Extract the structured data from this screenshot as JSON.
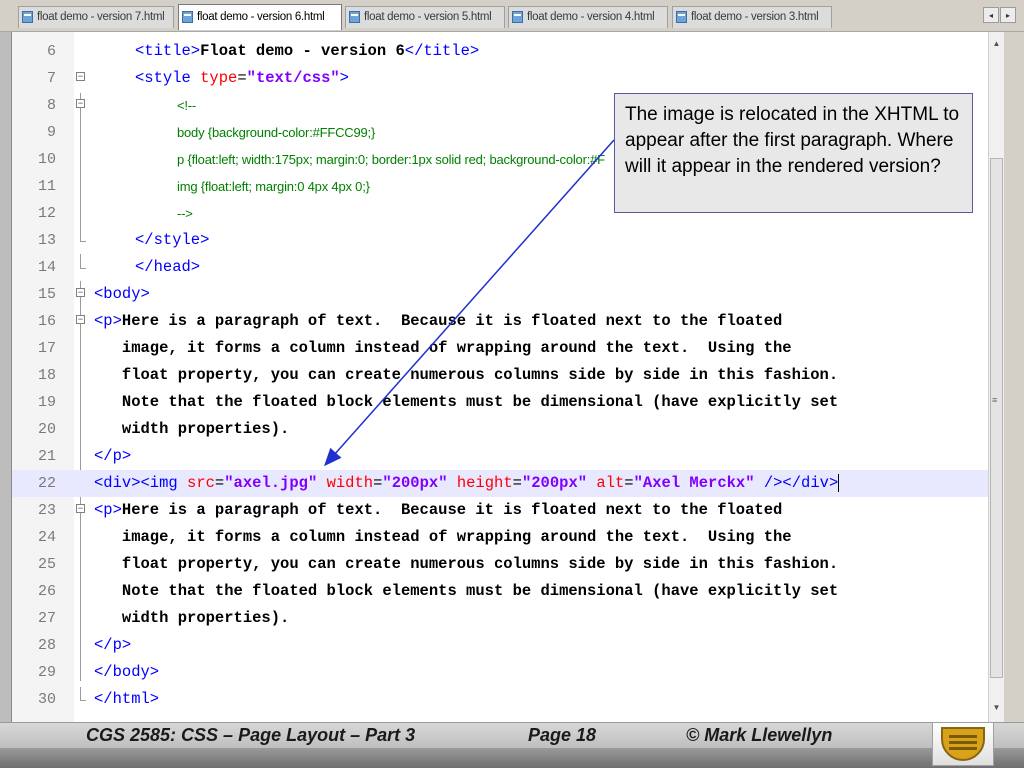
{
  "tabs": [
    {
      "label": "float demo - version 7.html",
      "active": false
    },
    {
      "label": "float demo - version 6.html",
      "active": true
    },
    {
      "label": "float demo - version 5.html",
      "active": false
    },
    {
      "label": "float demo - version 4.html",
      "active": false
    },
    {
      "label": "float demo - version 3.html",
      "active": false
    }
  ],
  "nav": {
    "left_icon": "scroll-left-icon",
    "right_icon": "scroll-right-icon",
    "left_glyph": "◂",
    "right_glyph": "▸"
  },
  "editor": {
    "lines": {
      "l6": {
        "num": "6",
        "open": "<title>",
        "text": "Float demo - version 6",
        "close": "</title>"
      },
      "l7": {
        "num": "7",
        "open": "<style ",
        "attr": "type",
        "eq": "=",
        "val": "\"text/css\"",
        "close": ">"
      },
      "l8": {
        "num": "8",
        "text": "<!--"
      },
      "l9": {
        "num": "9",
        "text": "body {background-color:#FFCC99;}"
      },
      "l10": {
        "num": "10",
        "text": "p {float:left; width:175px; margin:0; border:1px solid red; background-color:#F"
      },
      "l11": {
        "num": "11",
        "text": "img {float:left; margin:0 4px 4px 0;}"
      },
      "l12": {
        "num": "12",
        "text": "-->"
      },
      "l13": {
        "num": "13",
        "text": "</style>"
      },
      "l14": {
        "num": "14",
        "text": "</head>"
      },
      "l15": {
        "num": "15",
        "text": "<body>"
      },
      "l16": {
        "num": "16",
        "open": "<p>",
        "text": "Here is a paragraph of text.  Because it is floated next to the floated"
      },
      "l17": {
        "num": "17",
        "text": "   image, it forms a column instead of wrapping around the text.  Using the"
      },
      "l18": {
        "num": "18",
        "text": "   float property, you can create numerous columns side by side in this fashion."
      },
      "l19": {
        "num": "19",
        "text": "   Note that the floated block elements must be dimensional (have explicitly set"
      },
      "l20": {
        "num": "20",
        "text": "   width properties)."
      },
      "l21": {
        "num": "21",
        "text": "</p>"
      },
      "l22": {
        "num": "22",
        "div_open": "<div><img ",
        "a1": "src",
        "v1": "\"axel.jpg\"",
        "a2": "width",
        "v2": "\"200px\"",
        "a3": "height",
        "v3": "\"200px\"",
        "a4": "alt",
        "v4": "\"Axel Merckx\"",
        "eq": "=",
        "sp": " ",
        "close": " /></div>"
      },
      "l23": {
        "num": "23",
        "open": "<p>",
        "text": "Here is a paragraph of text.  Because it is floated next to the floated"
      },
      "l24": {
        "num": "24",
        "text": "   image, it forms a column instead of wrapping around the text.  Using the"
      },
      "l25": {
        "num": "25",
        "text": "   float property, you can create numerous columns side by side in this fashion."
      },
      "l26": {
        "num": "26",
        "text": "   Note that the floated block elements must be dimensional (have explicitly set"
      },
      "l27": {
        "num": "27",
        "text": "   width properties)."
      },
      "l28": {
        "num": "28",
        "text": "</p>"
      },
      "l29": {
        "num": "29",
        "text": "</body>"
      },
      "l30": {
        "num": "30",
        "text": "</html>"
      }
    },
    "fold_glyph": "−"
  },
  "callout": {
    "text": "The image is relocated in the XHTML to appear after the first paragraph.  Where will it appear in the rendered version?"
  },
  "footer": {
    "course": "CGS 2585: CSS – Page Layout – Part 3",
    "page": "Page 18",
    "author": "© Mark Llewellyn"
  },
  "scrollbar": {
    "up_glyph": "▲",
    "down_glyph": "▼",
    "grip_glyph": "≡"
  },
  "colors": {
    "tag": "#0000ff",
    "attribute": "#ff0000",
    "value": "#8000ff",
    "css_comment": "#008000",
    "callout_border": "#5a5aa0",
    "arrow": "#1f2fd0"
  }
}
